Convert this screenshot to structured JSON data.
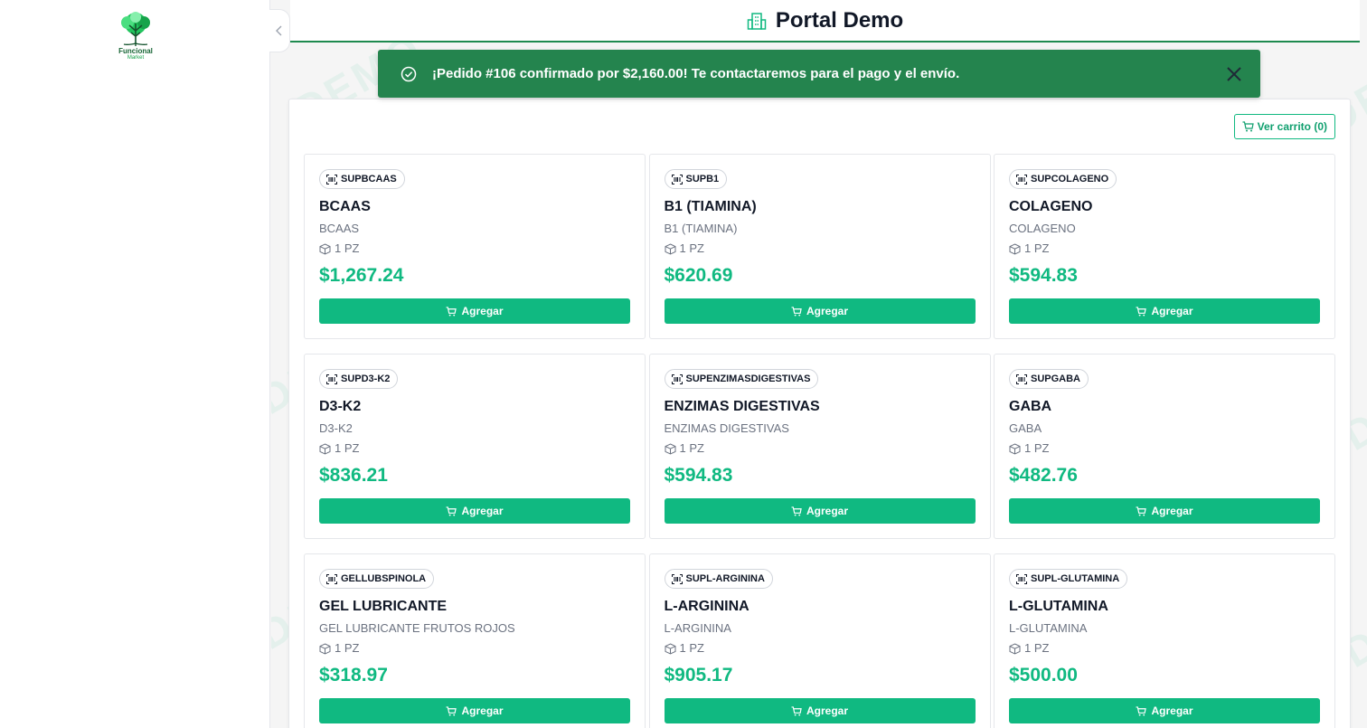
{
  "app": {
    "logo_name": "Funcional",
    "logo_sub": "Market",
    "title": "Portal Demo",
    "watermark": "DEMO"
  },
  "toast": {
    "message": "¡Pedido #106 confirmado por $2,160.00! Te contactaremos para el pago y el envío."
  },
  "cart": {
    "label": "Ver carrito (0)"
  },
  "add_label": "Agregar",
  "products": [
    {
      "sku": "SUPBCAAS",
      "name": "BCAAS",
      "desc": "BCAAS",
      "unit": "1 PZ",
      "price": "$1,267.24"
    },
    {
      "sku": "SUPB1",
      "name": "B1 (TIAMINA)",
      "desc": "B1 (TIAMINA)",
      "unit": "1 PZ",
      "price": "$620.69"
    },
    {
      "sku": "SUPCOLAGENO",
      "name": "COLAGENO",
      "desc": "COLAGENO",
      "unit": "1 PZ",
      "price": "$594.83"
    },
    {
      "sku": "SUPD3-K2",
      "name": "D3-K2",
      "desc": "D3-K2",
      "unit": "1 PZ",
      "price": "$836.21"
    },
    {
      "sku": "SUPENZIMASDIGESTIVAS",
      "name": "ENZIMAS DIGESTIVAS",
      "desc": "ENZIMAS DIGESTIVAS",
      "unit": "1 PZ",
      "price": "$594.83"
    },
    {
      "sku": "SUPGABA",
      "name": "GABA",
      "desc": "GABA",
      "unit": "1 PZ",
      "price": "$482.76"
    },
    {
      "sku": "GELLUBSPINOLA",
      "name": "GEL LUBRICANTE",
      "desc": "GEL LUBRICANTE FRUTOS ROJOS",
      "unit": "1 PZ",
      "price": "$318.97"
    },
    {
      "sku": "SUPL-ARGININA",
      "name": "L-ARGININA",
      "desc": "L-ARGININA",
      "unit": "1 PZ",
      "price": "$905.17"
    },
    {
      "sku": "SUPL-GLUTAMINA",
      "name": "L-GLUTAMINA",
      "desc": "L-GLUTAMINA",
      "unit": "1 PZ",
      "price": "$500.00"
    }
  ],
  "icons": {
    "logo": "tree-logo-icon",
    "collapse": "chevron-left-icon",
    "header": "building-icon",
    "toast": "check-circle-icon",
    "close": "close-icon",
    "cart": "cart-icon",
    "sku": "barcode-icon",
    "unit": "box-icon"
  },
  "colors": {
    "accent": "#10b981",
    "toast_bg": "#24844e",
    "header_border": "#1e8a4f"
  }
}
